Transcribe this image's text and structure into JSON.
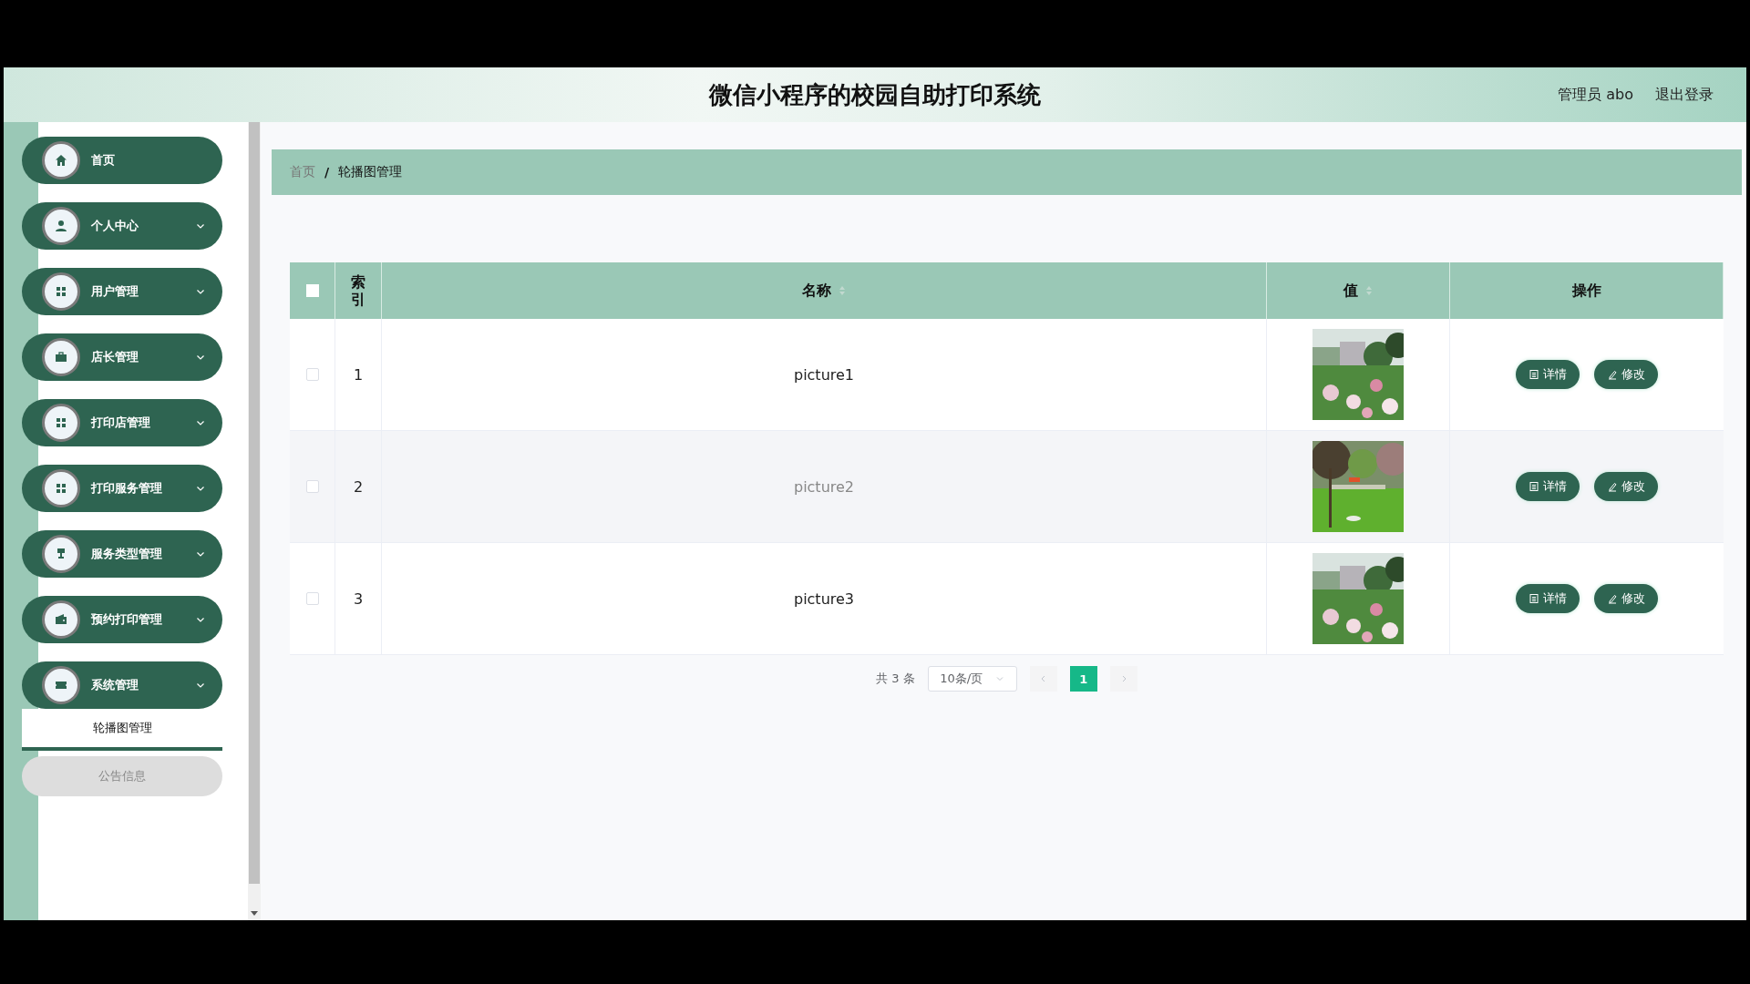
{
  "header": {
    "title": "微信小程序的校园自助打印系统",
    "user": "管理员 abo",
    "logout": "退出登录"
  },
  "sidebar": {
    "items": [
      {
        "label": "首页",
        "kind": "link"
      },
      {
        "label": "个人中心",
        "kind": "menu"
      },
      {
        "label": "用户管理",
        "kind": "menu"
      },
      {
        "label": "店长管理",
        "kind": "menu"
      },
      {
        "label": "打印店管理",
        "kind": "menu"
      },
      {
        "label": "打印服务管理",
        "kind": "menu"
      },
      {
        "label": "服务类型管理",
        "kind": "menu"
      },
      {
        "label": "预约打印管理",
        "kind": "menu"
      },
      {
        "label": "系统管理",
        "kind": "menu",
        "children": [
          {
            "label": "轮播图管理",
            "selected": true
          },
          {
            "label": "公告信息",
            "selected": false
          }
        ]
      }
    ]
  },
  "breadcrumb": {
    "separator": "/",
    "items": [
      "首页",
      "轮播图管理"
    ]
  },
  "table": {
    "select_all": {
      "checked": false
    },
    "columns": [
      {
        "label": "索引",
        "kind": "plain"
      },
      {
        "label": "名称",
        "kind": "sortable"
      },
      {
        "label": "值",
        "kind": "sortable"
      },
      {
        "label": "操作",
        "kind": "plain"
      }
    ],
    "rows": [
      {
        "checked": false,
        "index": "1",
        "name": "picture1",
        "highlighted": false,
        "actions": [
          "详情",
          "修改"
        ]
      },
      {
        "checked": false,
        "index": "2",
        "name": "picture2",
        "highlighted": true,
        "actions": [
          "详情",
          "修改"
        ]
      },
      {
        "checked": false,
        "index": "3",
        "name": "picture3",
        "highlighted": false,
        "actions": [
          "详情",
          "修改"
        ]
      }
    ]
  },
  "pagination": {
    "total": "共 3 条",
    "page_size": "10条/页",
    "prev_disabled": true,
    "next_disabled": true,
    "pages": [
      {
        "label": "1",
        "selected": true
      }
    ]
  }
}
